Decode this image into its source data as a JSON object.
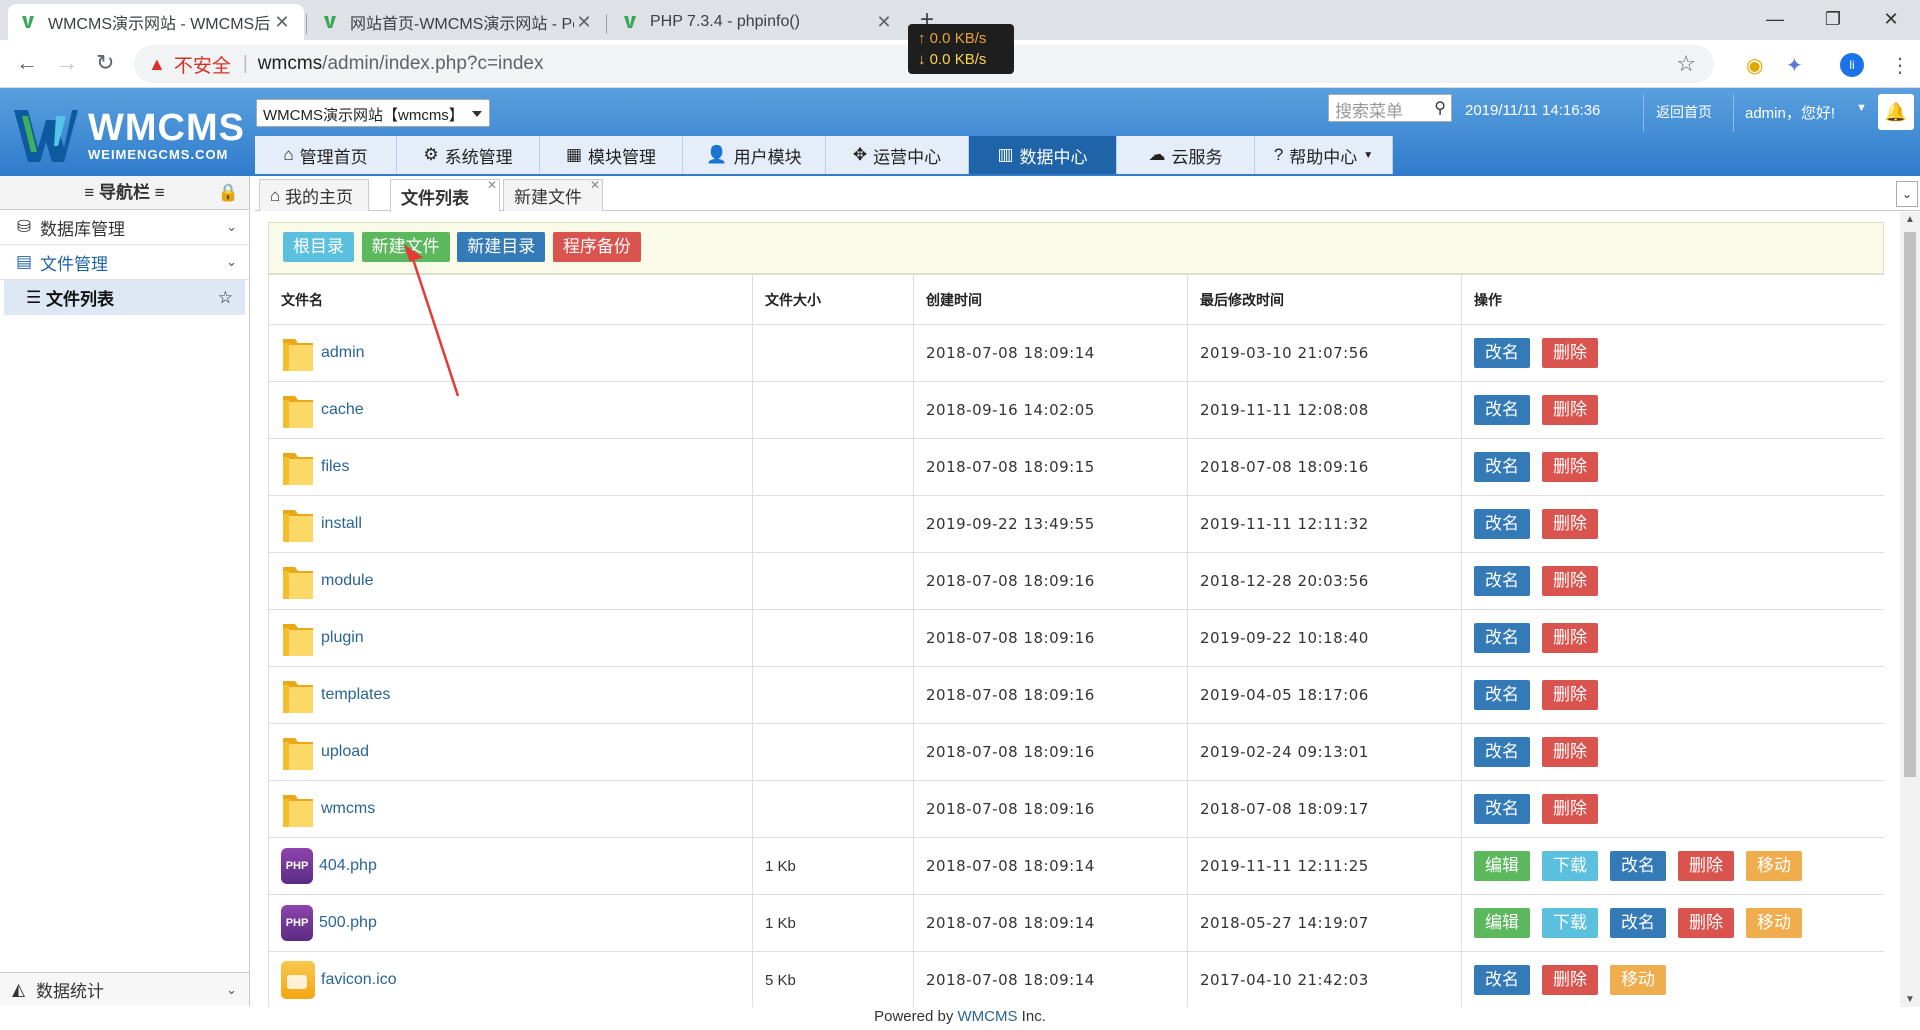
{
  "browser": {
    "tabs": [
      {
        "title": "WMCMS演示网站 - WMCMS后台管理"
      },
      {
        "title": "网站首页-WMCMS演示网站 - Powered"
      },
      {
        "title": "PHP 7.3.4 - phpinfo()"
      }
    ],
    "netspeed": {
      "up": "0.0 KB/s",
      "down": "0.0 KB/s"
    },
    "security_label": "不安全",
    "url_host": "wmcms",
    "url_path": "/admin/index.php?c=index",
    "profile_initial": "li"
  },
  "header": {
    "logo_big": "WMCMS",
    "logo_small": "WEIMENGCMS.COM",
    "site_select": "WMCMS演示网站【wmcms】",
    "search_placeholder": "搜索菜单",
    "datetime": "2019/11/11 14:16:36",
    "back_home": "返回首页",
    "greeting": "admin，您好!",
    "nav": [
      {
        "label": "管理首页",
        "icon": "home-icon"
      },
      {
        "label": "系统管理",
        "icon": "gear-icon"
      },
      {
        "label": "模块管理",
        "icon": "grid-icon"
      },
      {
        "label": "用户模块",
        "icon": "user-icon"
      },
      {
        "label": "运营中心",
        "icon": "move-icon"
      },
      {
        "label": "数据中心",
        "icon": "bar-chart-icon"
      },
      {
        "label": "云服务",
        "icon": "cloud-icon"
      },
      {
        "label": "帮助中心",
        "icon": "question-icon"
      }
    ]
  },
  "sidebar": {
    "title": "导航栏",
    "items": [
      {
        "label": "数据库管理"
      },
      {
        "label": "文件管理"
      }
    ],
    "sub_active": "文件列表",
    "bottom": "数据统计"
  },
  "content_tabs": [
    {
      "label": "我的主页"
    },
    {
      "label": "文件列表"
    },
    {
      "label": "新建文件"
    }
  ],
  "toolbar": {
    "root": "根目录",
    "new_file": "新建文件",
    "new_dir": "新建目录",
    "backup": "程序备份"
  },
  "table": {
    "headers": [
      "文件名",
      "文件大小",
      "创建时间",
      "最后修改时间",
      "操作"
    ],
    "rows": [
      {
        "name": "admin",
        "size": "",
        "created": "2018-07-08 18:09:14",
        "modified": "2019-03-10 21:07:56"
      },
      {
        "name": "cache",
        "size": "",
        "created": "2018-09-16 14:02:05",
        "modified": "2019-11-11 12:08:08"
      },
      {
        "name": "files",
        "size": "",
        "created": "2018-07-08 18:09:15",
        "modified": "2018-07-08 18:09:16"
      },
      {
        "name": "install",
        "size": "",
        "created": "2019-09-22 13:49:55",
        "modified": "2019-11-11 12:11:32"
      },
      {
        "name": "module",
        "size": "",
        "created": "2018-07-08 18:09:16",
        "modified": "2018-12-28 20:03:56"
      },
      {
        "name": "plugin",
        "size": "",
        "created": "2018-07-08 18:09:16",
        "modified": "2019-09-22 10:18:40"
      },
      {
        "name": "templates",
        "size": "",
        "created": "2018-07-08 18:09:16",
        "modified": "2019-04-05 18:17:06"
      },
      {
        "name": "upload",
        "size": "",
        "created": "2018-07-08 18:09:16",
        "modified": "2019-02-24 09:13:01"
      },
      {
        "name": "wmcms",
        "size": "",
        "created": "2018-07-08 18:09:16",
        "modified": "2018-07-08 18:09:17"
      },
      {
        "name": "404.php",
        "size": "1 Kb",
        "created": "2018-07-08 18:09:14",
        "modified": "2019-11-11 12:11:25"
      },
      {
        "name": "500.php",
        "size": "1 Kb",
        "created": "2018-07-08 18:09:14",
        "modified": "2018-05-27 14:19:07"
      },
      {
        "name": "favicon.ico",
        "size": "5 Kb",
        "created": "2018-07-08 18:09:14",
        "modified": "2017-04-10 21:42:03"
      }
    ],
    "actions": {
      "edit": "编辑",
      "download": "下载",
      "rename": "改名",
      "delete": "删除",
      "move": "移动"
    },
    "php_badge": "PHP"
  },
  "footer": {
    "prefix": "Powered by ",
    "link": "WMCMS",
    "suffix": " Inc."
  },
  "colors": {
    "header_blue": "#2f7ccc",
    "nav_active": "#1f63a8",
    "annotation_arrow": "#e53935"
  }
}
